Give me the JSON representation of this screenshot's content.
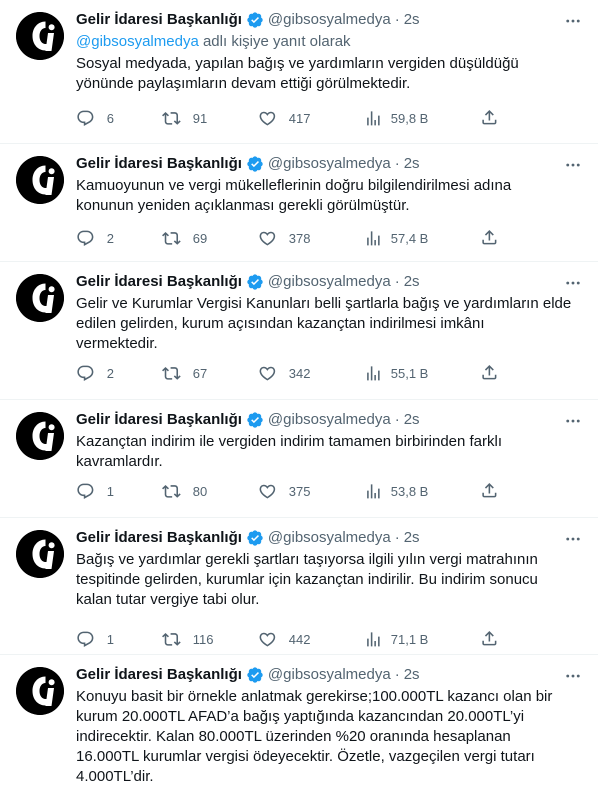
{
  "colors": {
    "accent": "#1d9bf0",
    "verified": "#1d9bf0",
    "secondary_text": "#536471",
    "text": "#0f1419"
  },
  "icons": {
    "avatar": "gib-logo",
    "verified": "verified-badge-icon",
    "more": "more-icon",
    "reply": "reply-icon",
    "retweet": "retweet-icon",
    "like": "heart-icon",
    "views": "views-icon",
    "share": "share-icon"
  },
  "tweets": [
    {
      "name": "Gelir İdaresi Başkanlığı",
      "handle": "@gibsosyalmedya",
      "dot": "·",
      "time": "2s",
      "reply_mention": "@gibsosyalmedya",
      "reply_suffix": " adlı kişiye yanıt olarak",
      "lines": [
        "Sosyal medyada, yapılan bağış ve yardımların vergiden düşüldüğü",
        "yönünde paylaşımların devam ettiği görülmektedir."
      ],
      "replies": "6",
      "retweets": "91",
      "likes": "417",
      "views": "59,8 B"
    },
    {
      "name": "Gelir İdaresi Başkanlığı",
      "handle": "@gibsosyalmedya",
      "dot": "·",
      "time": "2s",
      "lines": [
        "Kamuoyunun ve vergi mükelleflerinin doğru bilgilendirilmesi adına",
        "konunun yeniden açıklanması gerekli görülmüştür."
      ],
      "replies": "2",
      "retweets": "69",
      "likes": "378",
      "views": "57,4 B"
    },
    {
      "name": "Gelir İdaresi Başkanlığı",
      "handle": "@gibsosyalmedya",
      "dot": "·",
      "time": "2s",
      "lines": [
        "Gelir ve Kurumlar Vergisi Kanunları belli şartlarla bağış ve yardımların elde",
        "edilen gelirden, kurum açısından kazançtan indirilmesi imkânı",
        "vermektedir."
      ],
      "replies": "2",
      "retweets": "67",
      "likes": "342",
      "views": "55,1 B"
    },
    {
      "name": "Gelir İdaresi Başkanlığı",
      "handle": "@gibsosyalmedya",
      "dot": "·",
      "time": "2s",
      "lines": [
        "Kazançtan indirim ile vergiden indirim tamamen birbirinden farklı",
        "kavramlardır."
      ],
      "replies": "1",
      "retweets": "80",
      "likes": "375",
      "views": "53,8 B"
    },
    {
      "name": "Gelir İdaresi Başkanlığı",
      "handle": "@gibsosyalmedya",
      "dot": "·",
      "time": "2s",
      "lines": [
        "Bağış ve yardımlar gerekli şartları taşıyorsa ilgili yılın vergi matrahının",
        "tespitinde gelirden, kurumlar için kazançtan indirilir. Bu indirim sonucu",
        "kalan tutar vergiye tabi olur."
      ],
      "replies": "1",
      "retweets": "116",
      "likes": "442",
      "views": "71,1 B"
    },
    {
      "name": "Gelir İdaresi Başkanlığı",
      "handle": "@gibsosyalmedya",
      "dot": "·",
      "time": "2s",
      "lines": [
        "Konuyu basit bir örnekle anlatmak gerekirse;100.000TL kazancı olan bir",
        "kurum 20.000TL AFAD’a bağış yaptığında kazancından 20.000TL’yi",
        "indirecektir. Kalan 80.000TL üzerinden %20 oranında hesaplanan",
        "16.000TL kurumlar vergisi ödeyecektir. Özetle, vazgeçilen vergi tutarı",
        "4.000TL’dir."
      ]
    }
  ]
}
